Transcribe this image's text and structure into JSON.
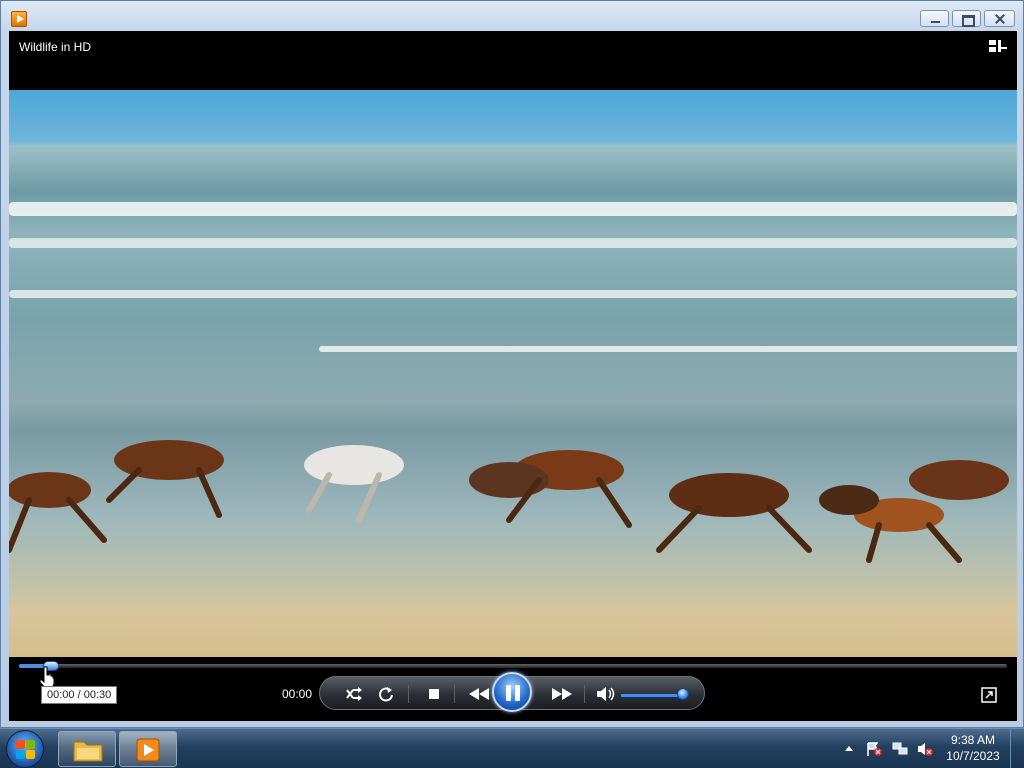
{
  "window": {
    "app_icon": "media-player-icon",
    "buttons": {
      "minimize": "minimize-icon",
      "maximize": "maximize-icon",
      "close": "close-icon"
    }
  },
  "player": {
    "title": "Wildlife in HD",
    "switch_to_library_icon": "switch-to-library-icon",
    "seek": {
      "position_fraction": 0.0
    },
    "tooltip": "00:00 / 00:30",
    "current_time": "00:00",
    "volume_fraction": 1.0,
    "controls": {
      "shuffle": "shuffle-icon",
      "repeat": "repeat-icon",
      "stop": "stop-icon",
      "previous": "rewind-icon",
      "play_pause": "pause-icon",
      "next": "fast-forward-icon",
      "mute": "speaker-icon",
      "fullscreen": "fullscreen-icon"
    },
    "accent_color": "#2a78d8"
  },
  "taskbar": {
    "start": "windows-start-icon",
    "items": [
      {
        "name": "file-explorer-icon"
      },
      {
        "name": "media-player-icon"
      }
    ],
    "tray": [
      "show-hidden-icons-arrow",
      "action-center-flag-icon",
      "network-icon",
      "volume-muted-icon"
    ],
    "clock": {
      "time": "9:38 AM",
      "date": "10/7/2023"
    }
  }
}
